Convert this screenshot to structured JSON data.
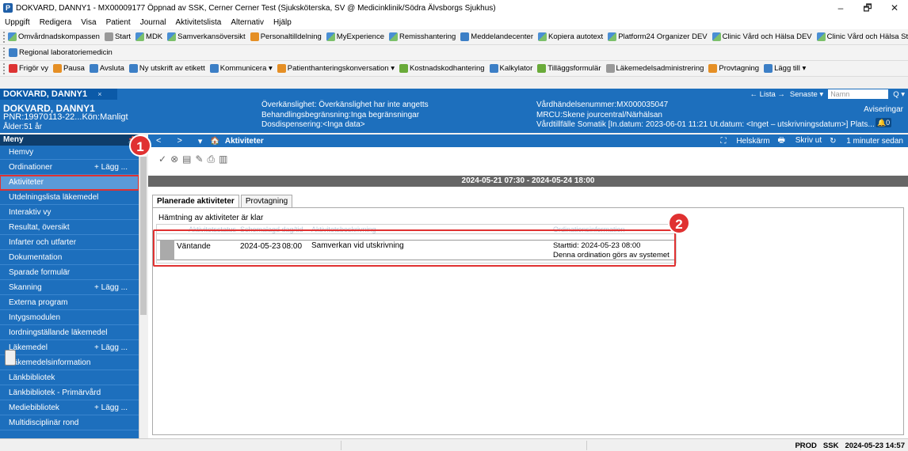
{
  "window": {
    "app_icon": "P",
    "title": "DOKVARD, DANNY1 - MX00009177 Öppnad av SSK, Cerner Cerner Test (Sjuksköterska, SV @ Medicinklinik/Södra Älvsborgs Sjukhus)",
    "minimize": "–",
    "maximize": "🗗",
    "close": "✕"
  },
  "menubar": [
    "Uppgift",
    "Redigera",
    "Visa",
    "Patient",
    "Journal",
    "Aktivitetslista",
    "Alternativ",
    "Hjälp"
  ],
  "toolbar1": [
    {
      "label": "Omvårdnadskompassen",
      "icon": "grid-icon"
    },
    {
      "label": "Start",
      "icon": "start-icon"
    },
    {
      "label": "MDK",
      "icon": "grid-icon"
    },
    {
      "label": "Samverkansöversikt",
      "icon": "grid-icon"
    },
    {
      "label": "Personaltilldelning",
      "icon": "people-icon"
    },
    {
      "label": "MyExperience",
      "icon": "grid-icon"
    },
    {
      "label": "Remisshantering",
      "icon": "grid-icon"
    },
    {
      "label": "Meddelandecenter",
      "icon": "mail-icon"
    },
    {
      "label": "Kopiera autotext",
      "icon": "grid-icon"
    },
    {
      "label": "Platform24 Organizer DEV",
      "icon": "grid-icon"
    },
    {
      "label": "Clinic Vård och Hälsa DEV",
      "icon": "grid-icon"
    },
    {
      "label": "Clinic Vård och Hälsa Staging",
      "icon": "grid-icon"
    }
  ],
  "toolbar2": [
    {
      "label": "Regional laboratoriemedicin",
      "icon": "lab-icon"
    }
  ],
  "toolbar3": [
    {
      "label": "Frigör vy",
      "icon": "unlock-icon"
    },
    {
      "label": "Pausa",
      "icon": "pause-icon"
    },
    {
      "label": "Avsluta",
      "icon": "exit-icon"
    },
    {
      "label": "Ny utskrift av etikett",
      "icon": "label-icon"
    },
    {
      "label": "Kommunicera ▾",
      "icon": "communicate-icon"
    },
    {
      "label": "Patienthanteringskonversation ▾",
      "icon": "patient-icon"
    },
    {
      "label": "Kostnadskodhantering",
      "icon": "cost-icon"
    },
    {
      "label": "Kalkylator",
      "icon": "calculator-icon"
    },
    {
      "label": "Tilläggsformulär",
      "icon": "form-icon"
    },
    {
      "label": "Läkemedelsadministrering",
      "icon": "barcode-icon"
    },
    {
      "label": "Provtagning",
      "icon": "sample-icon"
    },
    {
      "label": "Lägg till ▾",
      "icon": "plus-icon"
    }
  ],
  "patient_tab": {
    "name": "DOKVARD, DANNY1",
    "close": "×",
    "lista": "← Lista →",
    "senaste": "Senaste ▾",
    "search_placeholder": "Namn",
    "search_icon": "Q ▾"
  },
  "banner": {
    "name": "DOKVARD, DANNY1",
    "pnr": "PNR:19970113-22...Kön:Manligt",
    "alder": "Ålder:51 år",
    "col2": [
      "Överkänslighet: Överkänslighet har inte angetts",
      "Behandlingsbegränsning:Inga begränsningar",
      "Dosdispensering:<Inga data>"
    ],
    "col3": [
      "Vårdhändelsenummer:MX000035047",
      "MRCU:Skene jourcentral/Närhälsan",
      "Vårdtillfälle Somatik [In.datum: 2023-06-01 11:21 Ut.datum: <Inget – utskrivningsdatum>] Plats..."
    ],
    "aviseringar": "Aviseringar",
    "bell_count": "0"
  },
  "sidebar": {
    "header": "Meny",
    "pin": "📌",
    "add_label": "+ Lägg ...",
    "items": [
      {
        "label": "Hemvy",
        "add": false
      },
      {
        "label": "Ordinationer",
        "add": true
      },
      {
        "label": "Aktiviteter",
        "add": false,
        "active": true
      },
      {
        "label": "Utdelningslista läkemedel",
        "add": false
      },
      {
        "label": "Interaktiv vy",
        "add": false
      },
      {
        "label": "Resultat, översikt",
        "add": false
      },
      {
        "label": "Infarter och utfarter",
        "add": false
      },
      {
        "label": "Dokumentation",
        "add": false
      },
      {
        "label": "Sparade formulär",
        "add": false
      },
      {
        "label": "Skanning",
        "add": true
      },
      {
        "label": "Externa program",
        "add": false
      },
      {
        "label": "Intygsmodulen",
        "add": false
      },
      {
        "label": "Iordningställande läkemedel",
        "add": false
      },
      {
        "label": "Läkemedel",
        "add": true
      },
      {
        "label": "Läkemedelsinformation",
        "add": false
      },
      {
        "label": "Länkbibliotek",
        "add": false
      },
      {
        "label": "Länkbibliotek - Primärvård",
        "add": false
      },
      {
        "label": "Mediebibliotek",
        "add": true
      },
      {
        "label": "Multidisciplinär rond",
        "add": false
      }
    ]
  },
  "main": {
    "back": "<",
    "forward": ">",
    "dropdown": "▾",
    "home_icon": "🏠",
    "title": "Aktiviteter",
    "helskarm": "Helskärm",
    "skriv_ut": "Skriv ut",
    "refresh": "1 minuter sedan",
    "date_range": "2024-05-21 07:30 - 2024-05-24 18:00",
    "tabs": [
      "Planerade aktiviteter",
      "Provtagning"
    ],
    "status_text": "Hämtning av aktiviteter är klar",
    "columns": [
      "Aktivitetsstatus",
      "Schemalagd dag/tid",
      "Aktivitetsbeskrivning",
      "Ordinationsinformation"
    ],
    "rows": [
      {
        "status": "Väntande",
        "date": "2024-05-23",
        "time": "08:00",
        "description": "Samverkan vid utskrivning",
        "info_1": "Starttid: 2024-05-23 08:00",
        "info_2": "Denna ordination görs av systemet"
      }
    ]
  },
  "badges": [
    "1",
    "2"
  ],
  "statusbar": {
    "env": "PROD",
    "user": "SSK",
    "datetime": "2024-05-23 14:57"
  },
  "colors": {
    "accent_blue": "#1d6fbd",
    "dark_navy": "#0e3d6b",
    "callout_red": "#e03131"
  }
}
